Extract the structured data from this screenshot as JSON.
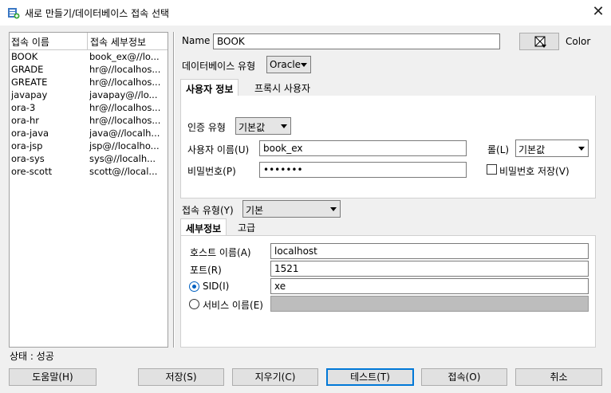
{
  "window": {
    "title": "새로 만들기/데이터베이스 접속 선택",
    "close_icon": "close-icon"
  },
  "connections": {
    "columns": [
      "접속 이름",
      "접속 세부정보"
    ],
    "rows": [
      {
        "name": "BOOK",
        "detail": "book_ex@//lo..."
      },
      {
        "name": "GRADE",
        "detail": "hr@//localhos..."
      },
      {
        "name": "GREATE",
        "detail": "hr@//localhos..."
      },
      {
        "name": "javapay",
        "detail": "javapay@//lo..."
      },
      {
        "name": "ora-3",
        "detail": "hr@//localhos..."
      },
      {
        "name": "ora-hr",
        "detail": "hr@//localhos..."
      },
      {
        "name": "ora-java",
        "detail": "java@//localh..."
      },
      {
        "name": "ora-jsp",
        "detail": "jsp@//localho..."
      },
      {
        "name": "ora-sys",
        "detail": "sys@//localh..."
      },
      {
        "name": "ore-scott",
        "detail": "scott@//local..."
      }
    ]
  },
  "form": {
    "name_label": "Name",
    "name_value": "BOOK",
    "color_label": "Color",
    "db_type_label": "데이터베이스 유형",
    "db_type_value": "Oracle",
    "tabs": [
      "사용자 정보",
      "프록시 사용자"
    ],
    "auth_type_label": "인증 유형",
    "auth_type_value": "기본값",
    "username_label": "사용자 이름(U)",
    "username_value": "book_ex",
    "role_label": "롤(L)",
    "role_value": "기본값",
    "password_label": "비밀번호(P)",
    "password_value": "•••••••",
    "save_password_label": "비밀번호 저장(V)",
    "save_password_checked": false,
    "conn_type_label": "접속 유형(Y)",
    "conn_type_value": "기본",
    "detail_tabs": [
      "세부정보",
      "고급"
    ],
    "host_label": "호스트 이름(A)",
    "host_value": "localhost",
    "port_label": "포트(R)",
    "port_value": "1521",
    "sid_label": "SID(I)",
    "sid_value": "xe",
    "service_label": "서비스 이름(E)",
    "service_value": ""
  },
  "status": {
    "text": "상태 : 성공"
  },
  "buttons": {
    "help": "도움말(H)",
    "save": "저장(S)",
    "clear": "지우기(C)",
    "test": "테스트(T)",
    "connect": "접속(O)",
    "cancel": "취소"
  }
}
